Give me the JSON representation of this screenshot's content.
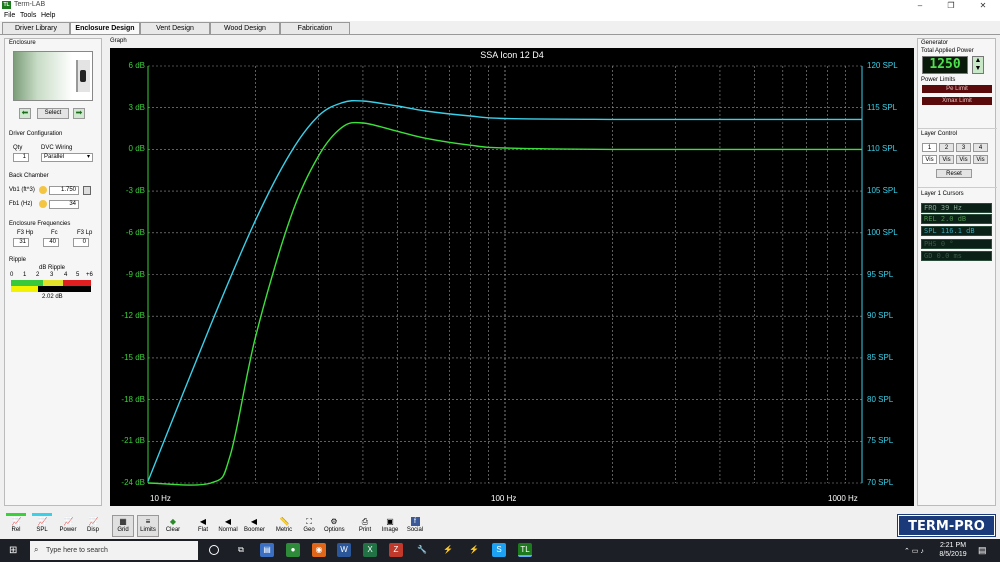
{
  "app": {
    "title": "Term-LAB",
    "logo": "TL"
  },
  "window_controls": [
    "–",
    "❐",
    "✕"
  ],
  "menu": [
    "File",
    "Tools",
    "Help"
  ],
  "tabs": [
    "Driver Library",
    "Enclosure Design",
    "Vent Design",
    "Wood Design",
    "Fabrication"
  ],
  "active_tab": "Enclosure Design",
  "left": {
    "enclosure_title": "Enclosure",
    "select_label": "Select",
    "driver_config_title": "Driver Configuration",
    "qty_label": "Qty",
    "qty_value": "1",
    "dvc_label": "DVC Wiring",
    "dvc_value": "Parallel",
    "back_chamber_title": "Back Chamber",
    "vb1_label": "Vb1 (ft^3)",
    "vb1_value": "1.750",
    "fb1_label": "Fb1 (Hz)",
    "fb1_value": "34",
    "enc_freq_title": "Enclosure Frequencies",
    "f3hp_label": "F3 Hp",
    "f3hp_value": "31",
    "fc_label": "Fc",
    "fc_value": "40",
    "f3lp_label": "F3 Lp",
    "f3lp_value": "0",
    "ripple_title": "Ripple",
    "db_ripple_label": "dB Ripple",
    "ripple_scale": [
      "0",
      "1",
      "2",
      "3",
      "4",
      "5",
      "+6"
    ],
    "ripple_value": "2.02 dB"
  },
  "graph": {
    "section_label": "Graph",
    "title": "SSA Icon 12 D4"
  },
  "chart_data": {
    "type": "line",
    "title": "SSA Icon 12 D4",
    "x_scale": "log",
    "xlim": [
      10,
      1000
    ],
    "x_tick_labels": [
      "10 Hz",
      "100 Hz",
      "1000 Hz"
    ],
    "ylim_left": [
      -24,
      6
    ],
    "ylim_right": [
      70,
      120
    ],
    "left_ticks": [
      "6 dB",
      "3 dB",
      "0 dB",
      "-3 dB",
      "-6 dB",
      "-9 dB",
      "-12 dB",
      "-15 dB",
      "-18 dB",
      "-21 dB",
      "-24 dB"
    ],
    "right_ticks": [
      "120 SPL",
      "115 SPL",
      "110 SPL",
      "105 SPL",
      "100 SPL",
      "95 SPL",
      "90 SPL",
      "85 SPL",
      "80 SPL",
      "75 SPL",
      "70 SPL"
    ],
    "grid": true,
    "series": [
      {
        "color": "#3ad0e8",
        "axis": "right",
        "x": [
          10,
          15,
          20,
          25,
          30,
          35,
          40,
          50,
          60,
          80,
          100,
          200,
          500,
          1000
        ],
        "y": [
          70.2,
          89,
          101.5,
          109.5,
          114,
          115.6,
          115.8,
          115.2,
          114.6,
          114.0,
          113.7,
          113.6,
          113.6,
          113.6
        ]
      },
      {
        "color": "#3ce03c",
        "axis": "left",
        "x": [
          10,
          15,
          17,
          20,
          25,
          30,
          35,
          40,
          50,
          60,
          80,
          100,
          200,
          500,
          1000
        ],
        "y": [
          -24,
          -24,
          -22,
          -13.5,
          -5,
          -0.5,
          1.6,
          1.9,
          1.3,
          0.8,
          0.3,
          0.1,
          0.0,
          0.0,
          0.0
        ]
      }
    ]
  },
  "right": {
    "generator_title": "Generator",
    "total_power_label": "Total Applied Power",
    "power_value": "1250",
    "power_limits_label": "Power Limits",
    "pe_limit": "Pe Limit",
    "xmax_limit": "Xmax Limit",
    "layer_control_title": "Layer Control",
    "layers": [
      "1",
      "2",
      "3",
      "4"
    ],
    "vis": [
      "Vis",
      "Vis",
      "Vis",
      "Vis"
    ],
    "reset_label": "Reset",
    "cursors_title": "Layer 1 Cursors",
    "cursors": [
      "FRQ      39 Hz",
      "REL      2.0 dB",
      "SPL  116.1 dB",
      "PHS      0 °",
      "GD       0.0 ms"
    ]
  },
  "bottom_tools": [
    "Rel",
    "SPL",
    "Power",
    "Disp",
    "Grid",
    "Limits",
    "Clear",
    "Flat",
    "Normal",
    "Boomer",
    "Metric",
    "Geo",
    "Options",
    "Print",
    "Image",
    "Social"
  ],
  "brand": "TERM-PRO",
  "taskbar": {
    "search_placeholder": "Type here to search",
    "time": "2:21 PM",
    "date": "8/5/2019"
  }
}
